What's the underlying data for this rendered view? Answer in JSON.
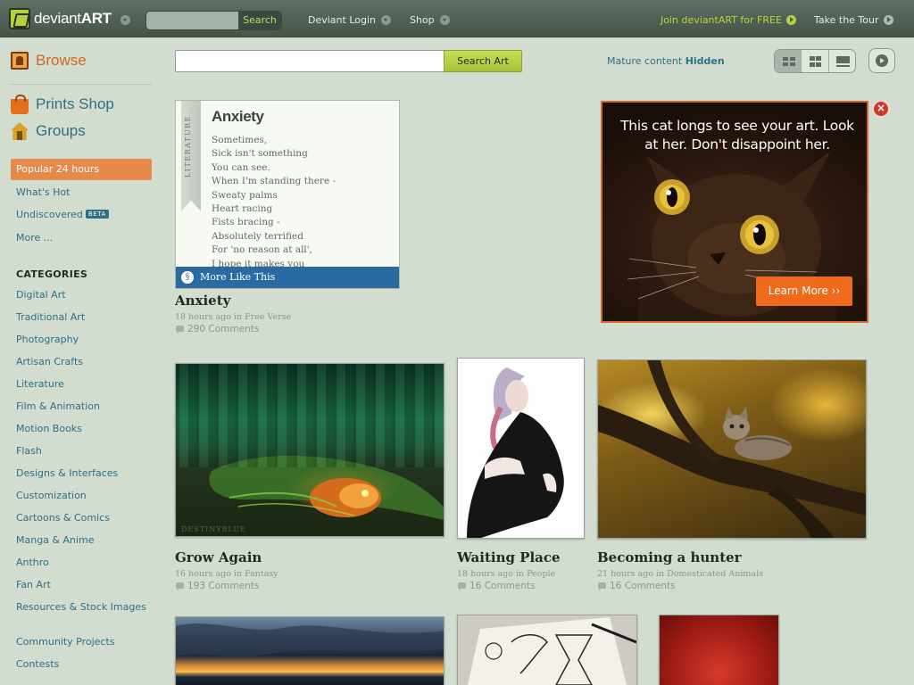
{
  "topbar": {
    "logo_plain": "deviant",
    "logo_bold": "ART",
    "search_placeholder": "",
    "search_button": "Search",
    "login": "Deviant Login",
    "shop": "Shop",
    "join": "Join deviantART for FREE",
    "tour": "Take the Tour"
  },
  "sidebar": {
    "browse": "Browse",
    "prints_shop": "Prints Shop",
    "groups": "Groups",
    "popular": "Popular 24 hours",
    "whats_hot": "What's Hot",
    "undiscovered": "Undiscovered",
    "beta": "BETA",
    "more": "More ...",
    "categories_heading": "CATEGORIES",
    "categories": [
      "Digital Art",
      "Traditional Art",
      "Photography",
      "Artisan Crafts",
      "Literature",
      "Film & Animation",
      "Motion Books",
      "Flash",
      "Designs & Interfaces",
      "Customization",
      "Cartoons & Comics",
      "Manga & Anime",
      "Anthro",
      "Fan Art",
      "Resources & Stock Images",
      "Community Projects",
      "Contests"
    ]
  },
  "main": {
    "search_button": "Search Art",
    "mature_label": "Mature content",
    "mature_value": "Hidden",
    "view_mode": "small-grid"
  },
  "literature": {
    "ribbon": "LITERATURE",
    "title": "Anxiety",
    "lines": [
      "Sometimes,",
      "Sick isn't something",
      "You can see.",
      "When I'm standing there -",
      "Sweaty palms",
      "Heart racing",
      "Fists bracing -",
      "Absolutely terrified",
      "For 'no reason at all',",
      "I hope it makes you"
    ],
    "more_like_this": "More Like This"
  },
  "ad": {
    "headline": "This cat longs to see your art. Look at her. Don't disappoint her.",
    "cta": "Learn More ››",
    "close": "×"
  },
  "deviations": [
    {
      "title": "Anxiety",
      "meta": "18 hours ago in Free Verse",
      "comments": "290 Comments"
    },
    {
      "title": "Grow Again",
      "meta": "16 hours ago in Fantasy",
      "comments": "193 Comments"
    },
    {
      "title": "Waiting Place",
      "meta": "18 hours ago in People",
      "comments": "16 Comments"
    },
    {
      "title": "Becoming a hunter",
      "meta": "21 hours ago in Domesticated Animals",
      "comments": "16 Comments"
    }
  ],
  "watermark": "DESTINYBLUE",
  "colors": {
    "accent_green": "#b9d23c",
    "link_blue": "#2f6f86",
    "popular_orange": "#e58a4b",
    "background": "#d2ddd0"
  }
}
